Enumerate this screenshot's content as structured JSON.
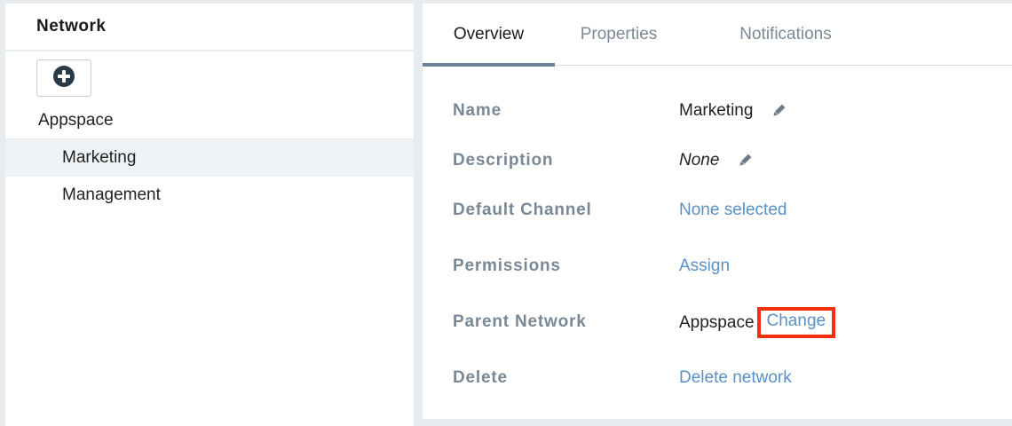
{
  "left": {
    "header": "Network",
    "root": "Appspace",
    "items": [
      {
        "label": "Marketing",
        "selected": true
      },
      {
        "label": "Management",
        "selected": false
      }
    ]
  },
  "tabs": [
    {
      "label": "Overview",
      "active": true
    },
    {
      "label": "Properties",
      "active": false
    },
    {
      "label": "Notifications",
      "active": false
    }
  ],
  "fields": {
    "name": {
      "label": "Name",
      "value": "Marketing"
    },
    "description": {
      "label": "Description",
      "value": "None"
    },
    "default_channel": {
      "label": "Default Channel",
      "value": "None selected"
    },
    "permissions": {
      "label": "Permissions",
      "value": "Assign"
    },
    "parent_network": {
      "label": "Parent Network",
      "value": "Appspace",
      "action": "Change"
    },
    "delete": {
      "label": "Delete",
      "value": "Delete network"
    }
  },
  "colors": {
    "link": "#5a90c8",
    "label": "#7a8896",
    "highlight": "#f2300c",
    "tab_indicator": "#6d8296"
  },
  "icons": [
    "plus-circle-icon",
    "pencil-icon"
  ]
}
